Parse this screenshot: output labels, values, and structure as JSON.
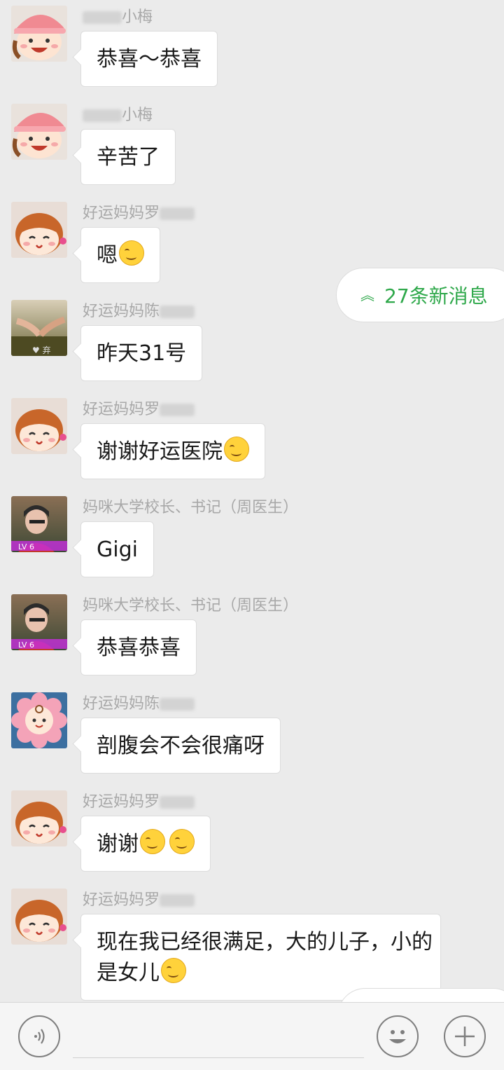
{
  "new_messages": {
    "label": "27条新消息",
    "arrow_icon": "double-chevron-up-icon"
  },
  "messages": [
    {
      "name_prefix": "",
      "name_suffix": "小梅",
      "text": "恭喜～恭喜",
      "emoji": 0,
      "avatar": "cartoon-girl-pink-cap-avatar"
    },
    {
      "name_prefix": "",
      "name_suffix": "小梅",
      "text": "辛苦了",
      "emoji": 0,
      "avatar": "cartoon-girl-pink-cap-avatar"
    },
    {
      "name_prefix": "好运妈妈罗",
      "name_suffix": "",
      "text": "嗯",
      "emoji": 1,
      "avatar": "cartoon-girl-pigtails-avatar"
    },
    {
      "name_prefix": "好运妈妈陈",
      "name_suffix": "",
      "text": "昨天31号",
      "emoji": 0,
      "avatar": "holding-hands-photo-avatar"
    },
    {
      "name_prefix": "好运妈妈罗",
      "name_suffix": "",
      "text": "谢谢好运医院",
      "emoji": 1,
      "avatar": "cartoon-girl-pigtails-avatar"
    },
    {
      "name_prefix": "妈咪大学校长、书记（周医生）",
      "name_suffix": "",
      "text": "Gigi",
      "emoji": 0,
      "avatar": "doctor-photo-avatar",
      "badge": "LV 6"
    },
    {
      "name_prefix": "妈咪大学校长、书记（周医生）",
      "name_suffix": "",
      "text": "恭喜恭喜",
      "emoji": 0,
      "avatar": "doctor-photo-avatar",
      "badge": "LV 6"
    },
    {
      "name_prefix": "好运妈妈陈",
      "name_suffix": "",
      "text": "剖腹会不会很痛呀",
      "emoji": 0,
      "avatar": "flower-baby-avatar"
    },
    {
      "name_prefix": "好运妈妈罗",
      "name_suffix": "",
      "text": "谢谢",
      "emoji": 2,
      "avatar": "cartoon-girl-pigtails-avatar"
    },
    {
      "name_prefix": "好运妈妈罗",
      "name_suffix": "",
      "text": "现在我已经很满足，大的儿子，小的",
      "text2": "是女儿",
      "emoji": 1,
      "avatar": "cartoon-girl-pigtails-avatar"
    }
  ],
  "input_bar": {
    "voice_icon": "voice-icon",
    "emoji_icon": "smiley-icon",
    "more_icon": "plus-icon"
  }
}
